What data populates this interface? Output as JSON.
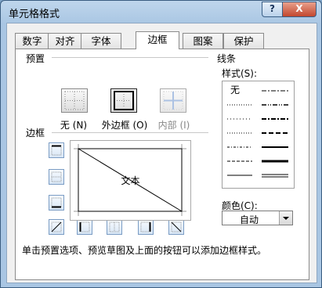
{
  "window": {
    "title": "单元格格式",
    "help_label": "?",
    "close_label": "X"
  },
  "tabs": [
    {
      "label": "数字",
      "active": false
    },
    {
      "label": "对齐",
      "active": false
    },
    {
      "label": "字体",
      "active": false
    },
    {
      "label": "边框",
      "active": true
    },
    {
      "label": "图案",
      "active": false
    },
    {
      "label": "保护",
      "active": false
    }
  ],
  "presets": {
    "section_label": "预置",
    "items": [
      {
        "label": "无 (N)",
        "enabled": true
      },
      {
        "label": "外边框 (O)",
        "enabled": true
      },
      {
        "label": "内部 (I)",
        "enabled": false
      }
    ]
  },
  "border": {
    "section_label": "边框",
    "preview_text": "文本"
  },
  "line": {
    "section_label": "线条",
    "style_label": "样式(S):",
    "none_label": "无"
  },
  "color": {
    "label": "颜色(C):",
    "value": "自动"
  },
  "help_text": "单击预置选项、预览草图及上面的按钮可以添加边框样式。"
}
